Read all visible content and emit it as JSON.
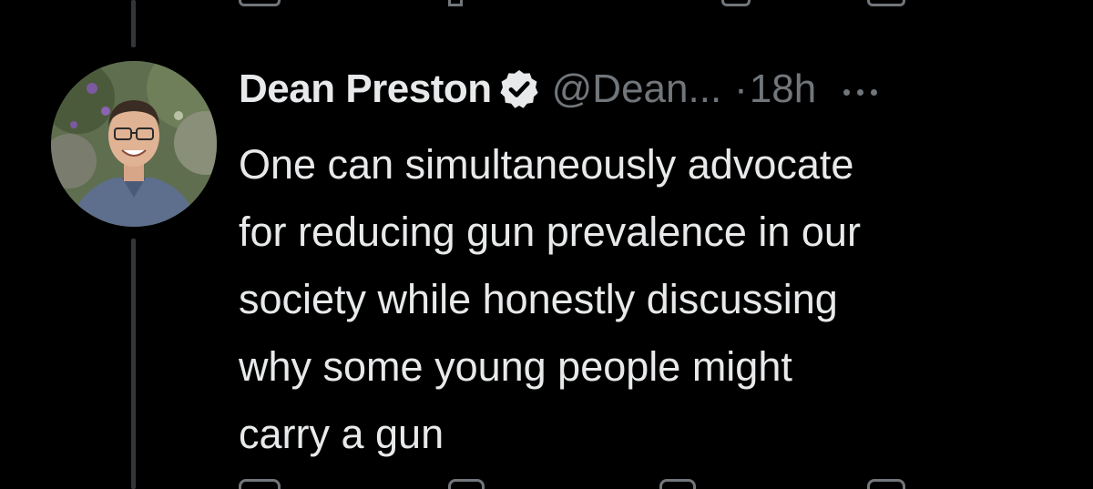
{
  "tweet": {
    "display_name": "Dean Preston",
    "verified_icon": "verified-badge-icon",
    "handle": "@Dean...",
    "separator": "·",
    "time": "18h",
    "more_icon": "more-options-icon",
    "text": "One can simultaneously advocate\nfor reducing gun prevalence in our\nsociety while honestly discussing\nwhy some young people might\ncarry a gun",
    "avatar_icon": "profile-photo"
  },
  "actions": {
    "reply_icon": "reply-icon",
    "retweet_icon": "retweet-icon",
    "like_icon": "like-icon",
    "share_icon": "share-icon"
  },
  "colors": {
    "background": "#000000",
    "primary_text": "#e7e9ea",
    "secondary_text": "#71767b",
    "thread_line": "#333639"
  }
}
